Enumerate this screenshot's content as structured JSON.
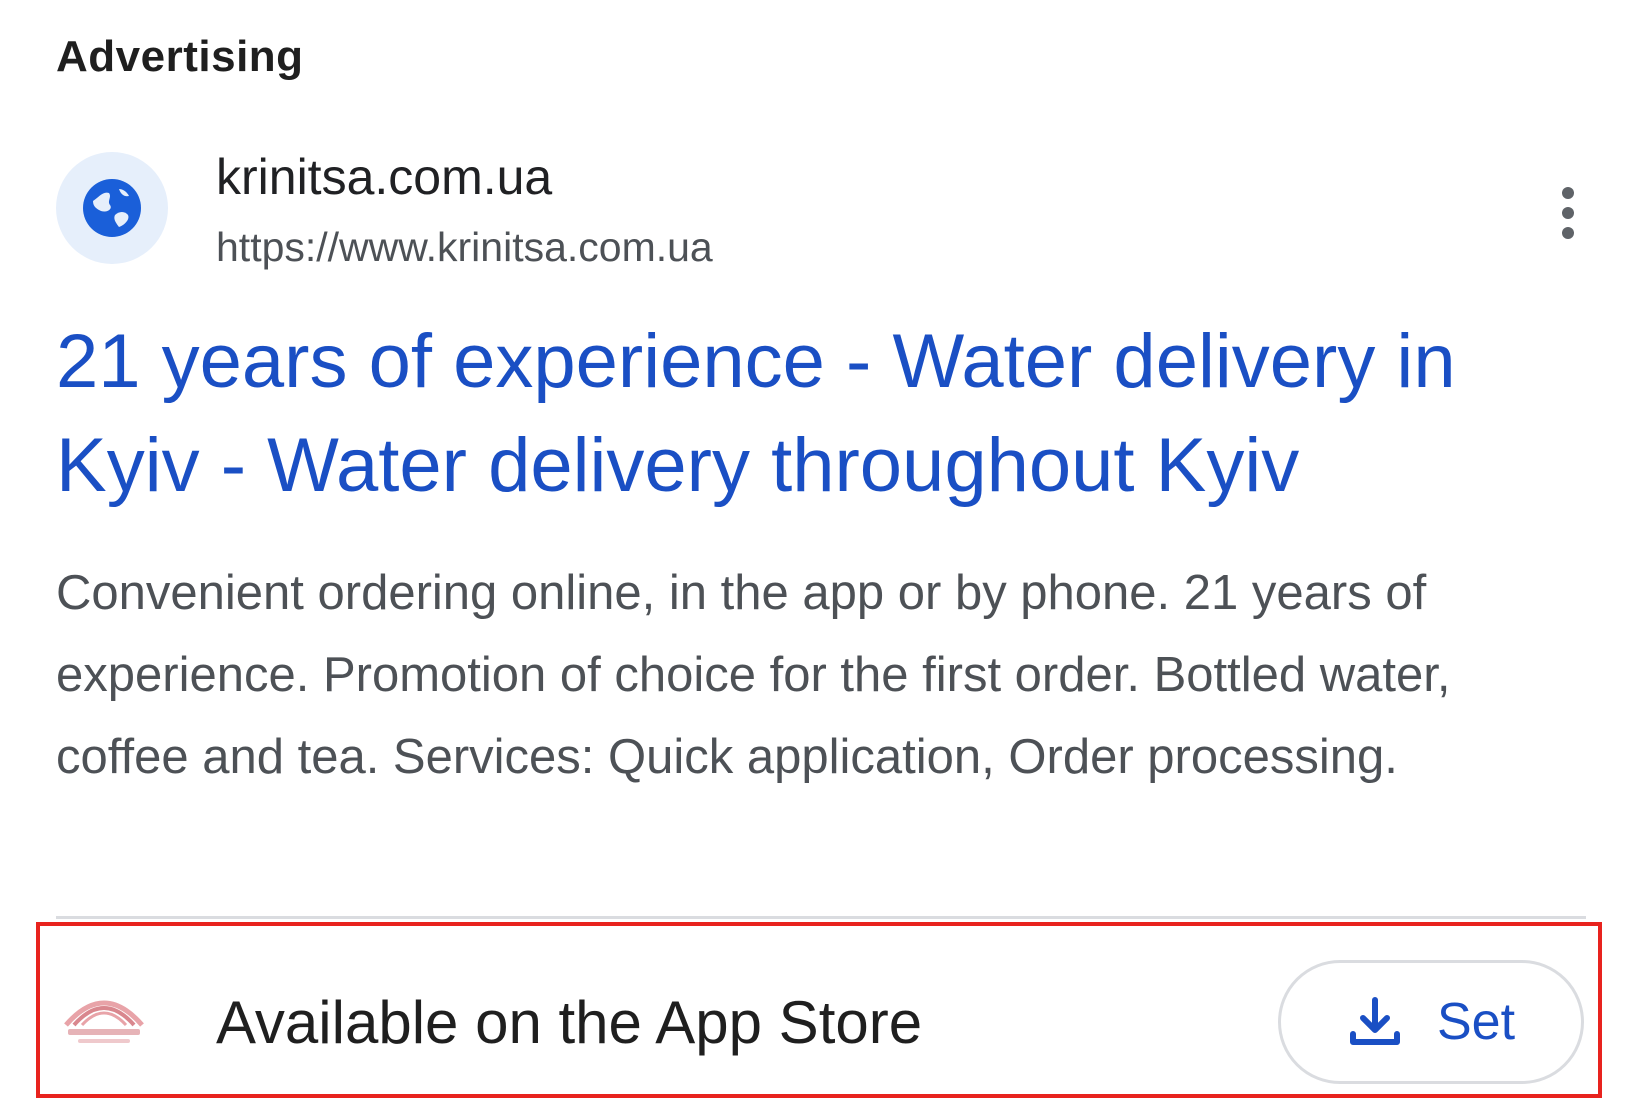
{
  "section_label": "Advertising",
  "ad": {
    "site_name": "krinitsa.com.ua",
    "site_url": "https://www.krinitsa.com.ua",
    "title": "21 years of experience - Water delivery in Kyiv - Water delivery throughout Kyiv",
    "description": "Convenient ordering online, in the app or by phone. 21 years of experience. Promotion of choice for the first order. Bottled water, coffee and tea. Services: Quick application, Order processing.",
    "favicon_icon": "globe-icon",
    "menu_icon": "more-vert-icon"
  },
  "app_extension": {
    "text": "Available on the App Store",
    "button_label": "Set",
    "button_icon": "download-icon"
  },
  "colors": {
    "link_blue": "#1a4fc4",
    "favicon_bg": "#e6effb",
    "highlight_border": "#e8231e"
  }
}
